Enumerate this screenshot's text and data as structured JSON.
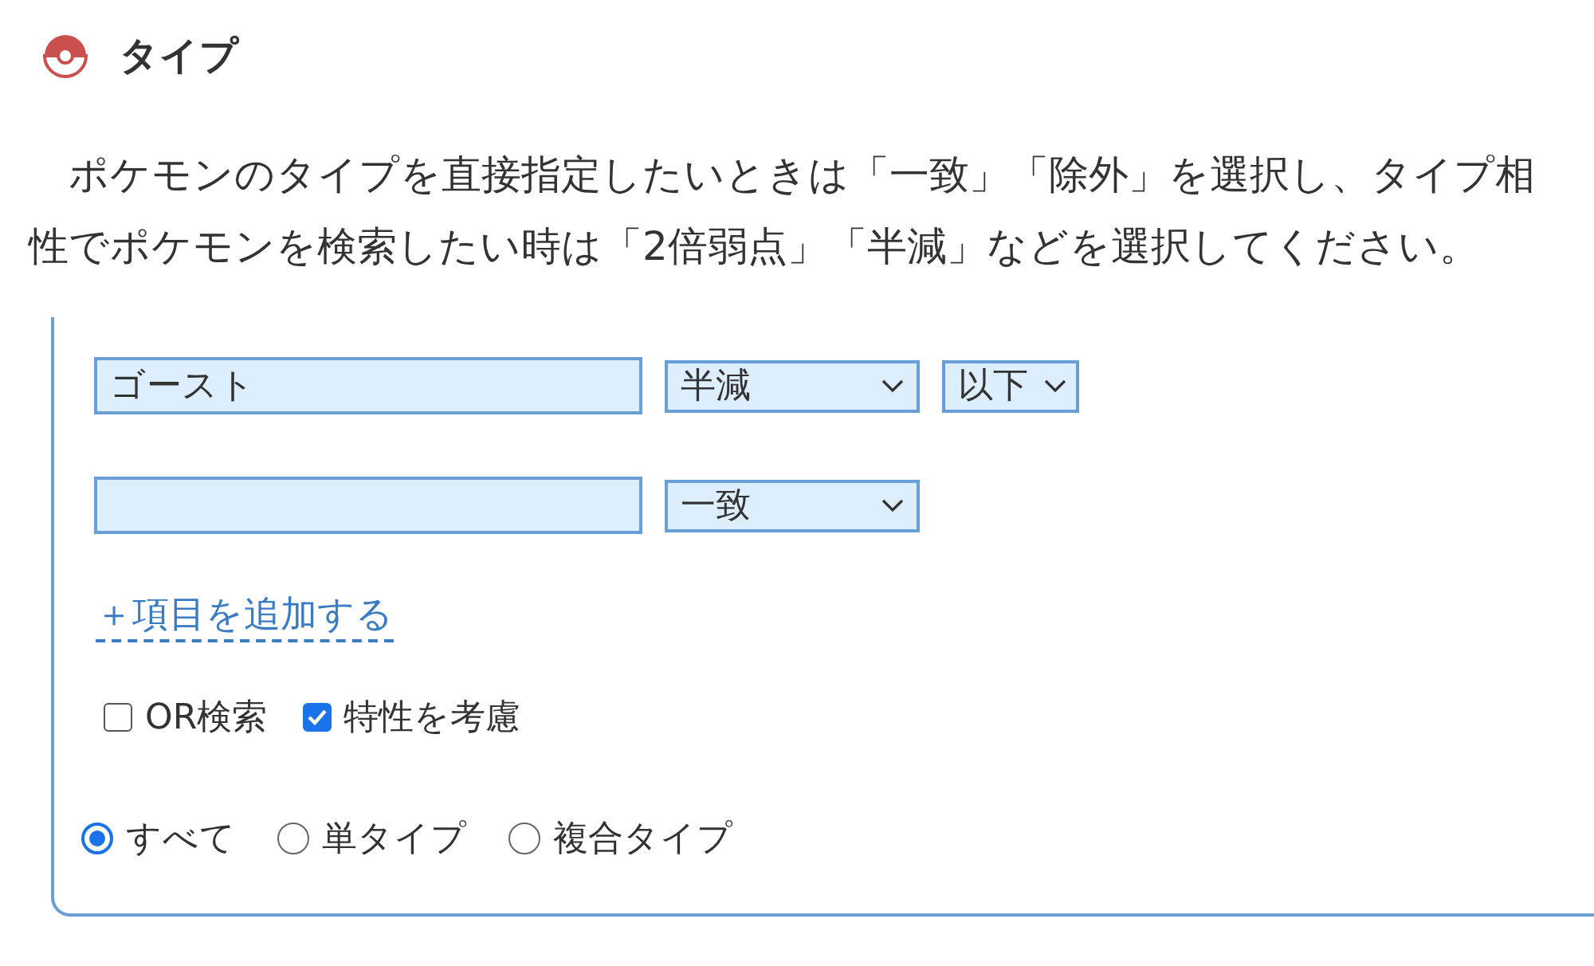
{
  "section": {
    "title": "タイプ",
    "description": "ポケモンのタイプを直接指定したいときは「一致」「除外」を選択し、タイプ相性でポケモンを検索したい時は「2倍弱点」「半減」などを選択してください。"
  },
  "filters": [
    {
      "type_value": "ゴースト",
      "relation": "半減",
      "comparison": "以下"
    },
    {
      "relation": "一致"
    }
  ],
  "add_link": "＋項目を追加する",
  "options": [
    {
      "label": "OR検索",
      "checked": false
    },
    {
      "label": "特性を考慮",
      "checked": true
    }
  ],
  "type_count": [
    {
      "label": "すべて",
      "selected": true
    },
    {
      "label": "単タイプ",
      "selected": false
    },
    {
      "label": "複合タイプ",
      "selected": false
    }
  ]
}
